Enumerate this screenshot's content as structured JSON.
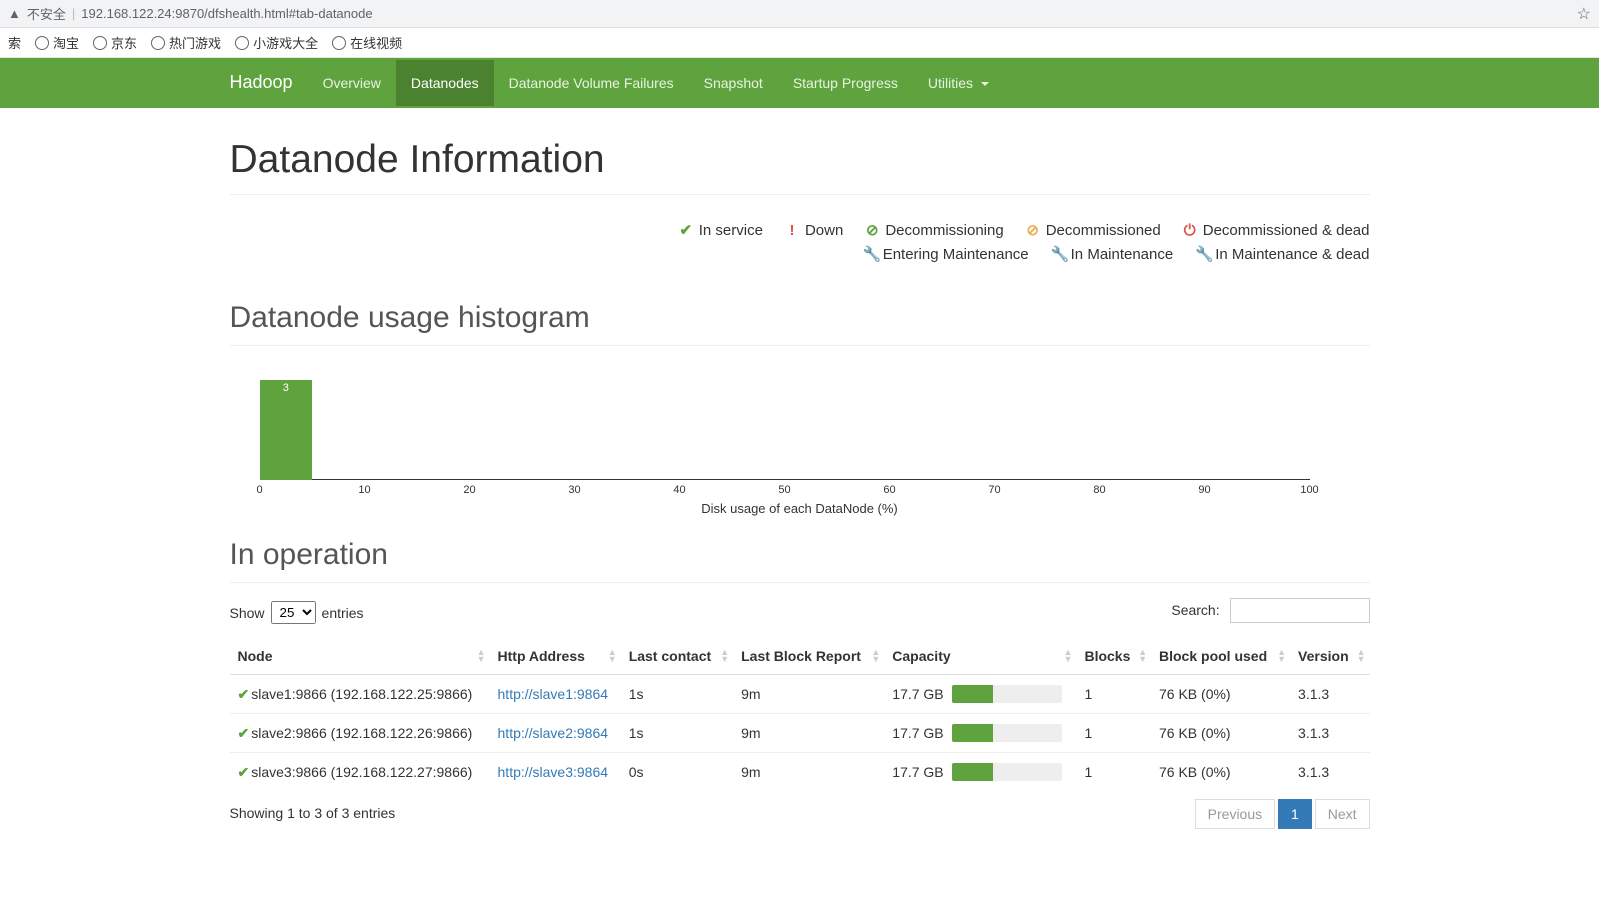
{
  "browser": {
    "insecure_label": "不安全",
    "url": "192.168.122.24:9870/dfshealth.html#tab-datanode",
    "bookmarks": [
      "索",
      "淘宝",
      "京东",
      "热门游戏",
      "小游戏大全",
      "在线视频"
    ]
  },
  "nav": {
    "brand": "Hadoop",
    "items": [
      "Overview",
      "Datanodes",
      "Datanode Volume Failures",
      "Snapshot",
      "Startup Progress",
      "Utilities"
    ],
    "active_index": 1
  },
  "page_title": "Datanode Information",
  "legend": [
    {
      "icon": "✔",
      "color": "#5fa33e",
      "label": "In service"
    },
    {
      "icon": "!",
      "color": "#d9534f",
      "label": "Down"
    },
    {
      "icon": "⊘",
      "color": "#5fa33e",
      "label": "Decommissioning"
    },
    {
      "icon": "⊘",
      "color": "#f0ad4e",
      "label": "Decommissioned"
    },
    {
      "icon": "⏻",
      "color": "#d9534f",
      "label": "Decommissioned & dead"
    },
    {
      "icon": "🔧",
      "color": "#5fa33e",
      "label": "Entering Maintenance"
    },
    {
      "icon": "🔧",
      "color": "#f0ad4e",
      "label": "In Maintenance"
    },
    {
      "icon": "🔧",
      "color": "#d9534f",
      "label": "In Maintenance & dead"
    }
  ],
  "histogram": {
    "title": "Datanode usage histogram",
    "xlabel": "Disk usage of each DataNode (%)",
    "ticks": [
      "0",
      "10",
      "20",
      "30",
      "40",
      "50",
      "60",
      "70",
      "80",
      "90",
      "100"
    ],
    "bars": [
      {
        "bin_start": 0,
        "bin_end": 5,
        "count": 3
      }
    ]
  },
  "chart_data": {
    "type": "bar",
    "title": "Datanode usage histogram",
    "xlabel": "Disk usage of each DataNode (%)",
    "ylabel": "",
    "xlim": [
      0,
      100
    ],
    "categories": [
      "0-5",
      "5-10",
      "10-15",
      "15-20",
      "20-25",
      "25-30",
      "30-35",
      "35-40",
      "40-45",
      "45-50",
      "50-55",
      "55-60",
      "60-65",
      "65-70",
      "70-75",
      "75-80",
      "80-85",
      "85-90",
      "90-95",
      "95-100"
    ],
    "values": [
      3,
      0,
      0,
      0,
      0,
      0,
      0,
      0,
      0,
      0,
      0,
      0,
      0,
      0,
      0,
      0,
      0,
      0,
      0,
      0
    ]
  },
  "in_operation": {
    "title": "In operation",
    "length_prefix": "Show",
    "length_value": "25",
    "length_suffix": "entries",
    "search_label": "Search:",
    "search_value": "",
    "columns": [
      "Node",
      "Http Address",
      "Last contact",
      "Last Block Report",
      "Capacity",
      "Blocks",
      "Block pool used",
      "Version"
    ],
    "rows": [
      {
        "node": "slave1:9866 (192.168.122.25:9866)",
        "http": "http://slave1:9864",
        "last_contact": "1s",
        "last_block": "9m",
        "capacity": "17.7 GB",
        "cap_pct": 38,
        "blocks": "1",
        "pool": "76 KB (0%)",
        "version": "3.1.3"
      },
      {
        "node": "slave2:9866 (192.168.122.26:9866)",
        "http": "http://slave2:9864",
        "last_contact": "1s",
        "last_block": "9m",
        "capacity": "17.7 GB",
        "cap_pct": 38,
        "blocks": "1",
        "pool": "76 KB (0%)",
        "version": "3.1.3"
      },
      {
        "node": "slave3:9866 (192.168.122.27:9866)",
        "http": "http://slave3:9864",
        "last_contact": "0s",
        "last_block": "9m",
        "capacity": "17.7 GB",
        "cap_pct": 38,
        "blocks": "1",
        "pool": "76 KB (0%)",
        "version": "3.1.3"
      }
    ],
    "info": "Showing 1 to 3 of 3 entries",
    "pagination": {
      "previous": "Previous",
      "pages": [
        "1"
      ],
      "next": "Next"
    }
  }
}
